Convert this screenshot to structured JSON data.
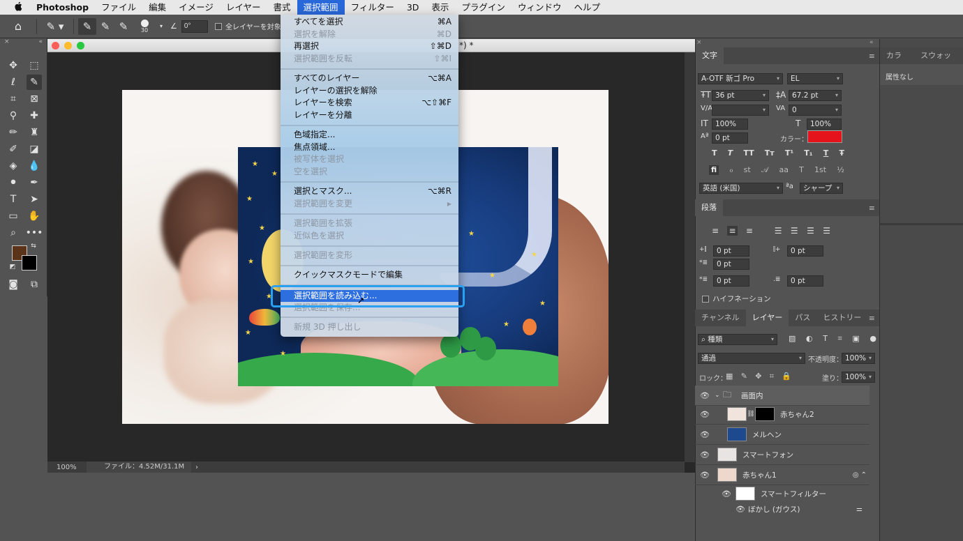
{
  "menubar": {
    "apple": "",
    "app": "Photoshop",
    "items": [
      "ファイル",
      "編集",
      "イメージ",
      "レイヤー",
      "書式",
      "選択範囲",
      "フィルター",
      "3D",
      "表示",
      "プラグイン",
      "ウィンドウ",
      "ヘルプ"
    ],
    "active_index": 5
  },
  "options_bar": {
    "brush_size": "30",
    "angle": "0°",
    "sample_all_layers": "全レイヤーを対象"
  },
  "document": {
    "title_suffix": "*) *",
    "zoom": "100%",
    "file_info": "ファイル：4.52M/31.1M",
    "status_arrow": "›"
  },
  "select_menu": {
    "items": [
      {
        "label": "すべてを選択",
        "shortcut": "⌘A",
        "disabled": false
      },
      {
        "label": "選択を解除",
        "shortcut": "⌘D",
        "disabled": true
      },
      {
        "label": "再選択",
        "shortcut": "⇧⌘D",
        "disabled": false
      },
      {
        "label": "選択範囲を反転",
        "shortcut": "⇧⌘I",
        "disabled": true
      },
      {
        "label": "すべてのレイヤー",
        "shortcut": "⌥⌘A",
        "disabled": false
      },
      {
        "label": "レイヤーの選択を解除",
        "shortcut": "",
        "disabled": false
      },
      {
        "label": "レイヤーを検索",
        "shortcut": "⌥⇧⌘F",
        "disabled": false
      },
      {
        "label": "レイヤーを分離",
        "shortcut": "",
        "disabled": false
      },
      {
        "label": "色域指定...",
        "shortcut": "",
        "disabled": false
      },
      {
        "label": "焦点領域...",
        "shortcut": "",
        "disabled": false
      },
      {
        "label": "被写体を選択",
        "shortcut": "",
        "disabled": true
      },
      {
        "label": "空を選択",
        "shortcut": "",
        "disabled": true
      },
      {
        "label": "選択とマスク...",
        "shortcut": "⌥⌘R",
        "disabled": false
      },
      {
        "label": "選択範囲を変更",
        "shortcut": "▶",
        "disabled": true
      },
      {
        "label": "選択範囲を拡張",
        "shortcut": "",
        "disabled": true
      },
      {
        "label": "近似色を選択",
        "shortcut": "",
        "disabled": true
      },
      {
        "label": "選択範囲を変形",
        "shortcut": "",
        "disabled": true
      },
      {
        "label": "クイックマスクモードで編集",
        "shortcut": "",
        "disabled": false
      },
      {
        "label": "選択範囲を読み込む...",
        "shortcut": "",
        "disabled": false,
        "highlighted": true
      },
      {
        "label": "選択範囲を保存...",
        "shortcut": "",
        "disabled": true
      },
      {
        "label": "新規 3D 押し出し",
        "shortcut": "",
        "disabled": true
      }
    ]
  },
  "character_panel": {
    "tab": "文字",
    "font_family": "A-OTF 新ゴ Pro",
    "font_style": "EL",
    "size": "36 pt",
    "leading": "67.2 pt",
    "kerning": "",
    "tracking": "0",
    "vscale": "100%",
    "hscale": "100%",
    "baseline": "0 pt",
    "color_label": "カラー：",
    "language": "英語 (米国)",
    "aa_label": "ªa",
    "antialias": "シャープ",
    "type_buttons": [
      "T",
      "T",
      "TT",
      "Tт",
      "T¹",
      "T₁",
      "T",
      "Ŧ"
    ],
    "opentype_buttons": [
      "fi",
      "ℴ",
      "st",
      "𝒜",
      "aa",
      "T",
      "1st",
      "½"
    ],
    "color": "#e4131c"
  },
  "side_panel": {
    "tabs": [
      "カラー",
      "スウォッチ"
    ],
    "empty": "属性なし"
  },
  "paragraph_panel": {
    "tab": "段落",
    "indent_left": "0 pt",
    "indent_right": "0 pt",
    "indent_first": "0 pt",
    "space_before": "0 pt",
    "space_after": "0 pt",
    "hyphenation": "ハイフネーション"
  },
  "layers_panel": {
    "tabs": [
      "チャンネル",
      "レイヤー",
      "パス",
      "ヒストリー"
    ],
    "active_tab": 1,
    "filter": "種類",
    "blend_mode": "通過",
    "opacity_label": "不透明度：",
    "opacity": "100%",
    "lock_label": "ロック：",
    "fill_label": "塗り：",
    "fill": "100%",
    "layers": [
      {
        "name": "画面内",
        "type": "group"
      },
      {
        "name": "赤ちゃん2",
        "type": "masked"
      },
      {
        "name": "メルヘン",
        "type": "smart"
      },
      {
        "name": "スマートフォン",
        "type": "smart"
      },
      {
        "name": "赤ちゃん1",
        "type": "smart"
      },
      {
        "name": "スマートフィルター",
        "type": "filter"
      },
      {
        "name": "ぼかし (ガウス)",
        "type": "filter-item"
      }
    ]
  }
}
